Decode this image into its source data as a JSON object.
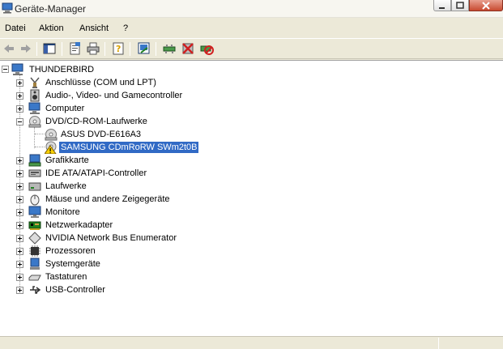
{
  "window": {
    "title": "Geräte-Manager",
    "icons": {
      "app": "device-manager-icon",
      "minimize": "minimize-icon",
      "maximize": "maximize-icon",
      "close": "close-icon"
    }
  },
  "menu": [
    "Datei",
    "Aktion",
    "Ansicht",
    "?"
  ],
  "toolbar": {
    "icons": [
      "back-arrow-icon",
      "forward-arrow-icon",
      "console-tree-icon",
      "properties-icon",
      "print-icon",
      "help-icon",
      "scan-hardware-icon",
      "update-driver-icon",
      "uninstall-icon",
      "disable-icon"
    ]
  },
  "tree": {
    "root": "THUNDERBIRD",
    "categories": [
      {
        "label": "Anschlüsse (COM und LPT)",
        "icon": "port-icon",
        "expanded": false
      },
      {
        "label": "Audio-, Video- und Gamecontroller",
        "icon": "speaker-icon",
        "expanded": false
      },
      {
        "label": "Computer",
        "icon": "computer-icon",
        "expanded": false
      },
      {
        "label": "DVD/CD-ROM-Laufwerke",
        "icon": "cdrom-icon",
        "expanded": true,
        "children": [
          {
            "label": "ASUS DVD-E616A3",
            "icon": "cdrom-icon",
            "selected": false
          },
          {
            "label": "SAMSUNG CDmRoRW SWm2t0B",
            "icon": "cdrom-warning-icon",
            "selected": true
          }
        ]
      },
      {
        "label": "Grafikkarte",
        "icon": "display-adapter-icon",
        "expanded": false
      },
      {
        "label": "IDE ATA/ATAPI-Controller",
        "icon": "ide-controller-icon",
        "expanded": false
      },
      {
        "label": "Laufwerke",
        "icon": "disk-drive-icon",
        "expanded": false
      },
      {
        "label": "Mäuse und andere Zeigegeräte",
        "icon": "mouse-icon",
        "expanded": false
      },
      {
        "label": "Monitore",
        "icon": "monitor-icon",
        "expanded": false
      },
      {
        "label": "Netzwerkadapter",
        "icon": "network-adapter-icon",
        "expanded": false
      },
      {
        "label": "NVIDIA Network Bus Enumerator",
        "icon": "bus-enumerator-icon",
        "expanded": false
      },
      {
        "label": "Prozessoren",
        "icon": "processor-icon",
        "expanded": false
      },
      {
        "label": "Systemgeräte",
        "icon": "system-device-icon",
        "expanded": false
      },
      {
        "label": "Tastaturen",
        "icon": "keyboard-icon",
        "expanded": false
      },
      {
        "label": "USB-Controller",
        "icon": "usb-icon",
        "expanded": false
      }
    ]
  },
  "colors": {
    "selection": "#316AC5",
    "chrome": "#ECE9D8",
    "pane": "#FFFFFF"
  }
}
